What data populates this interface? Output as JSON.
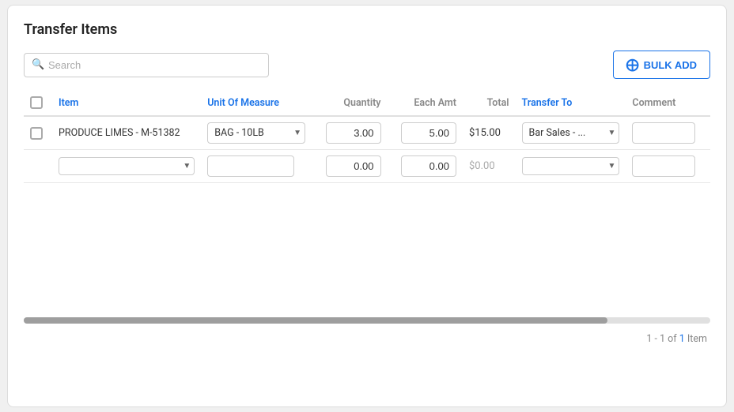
{
  "title": "Transfer Items",
  "toolbar": {
    "search_placeholder": "Search",
    "bulk_add_label": "BULK ADD"
  },
  "table": {
    "columns": [
      {
        "id": "check",
        "label": ""
      },
      {
        "id": "item",
        "label": "Item",
        "color_class": "col-item"
      },
      {
        "id": "uom",
        "label": "Unit Of Measure",
        "color_class": "col-uom"
      },
      {
        "id": "qty",
        "label": "Quantity"
      },
      {
        "id": "each",
        "label": "Each Amt"
      },
      {
        "id": "total",
        "label": "Total"
      },
      {
        "id": "transfer",
        "label": "Transfer To",
        "color_class": "col-transfer"
      },
      {
        "id": "comment",
        "label": "Comment"
      }
    ],
    "rows": [
      {
        "item_name": "PRODUCE LIMES - M-51382",
        "uom": "BAG - 10LB",
        "qty": "3.00",
        "each": "5.00",
        "total": "$15.00",
        "transfer_to": "Bar Sales - ...",
        "comment": "",
        "checked": false
      }
    ],
    "new_row": {
      "qty": "0.00",
      "each": "0.00",
      "total": "$0.00"
    }
  },
  "footer": {
    "pagination": "1 - 1 of",
    "count": "1",
    "item_label": "Item"
  }
}
